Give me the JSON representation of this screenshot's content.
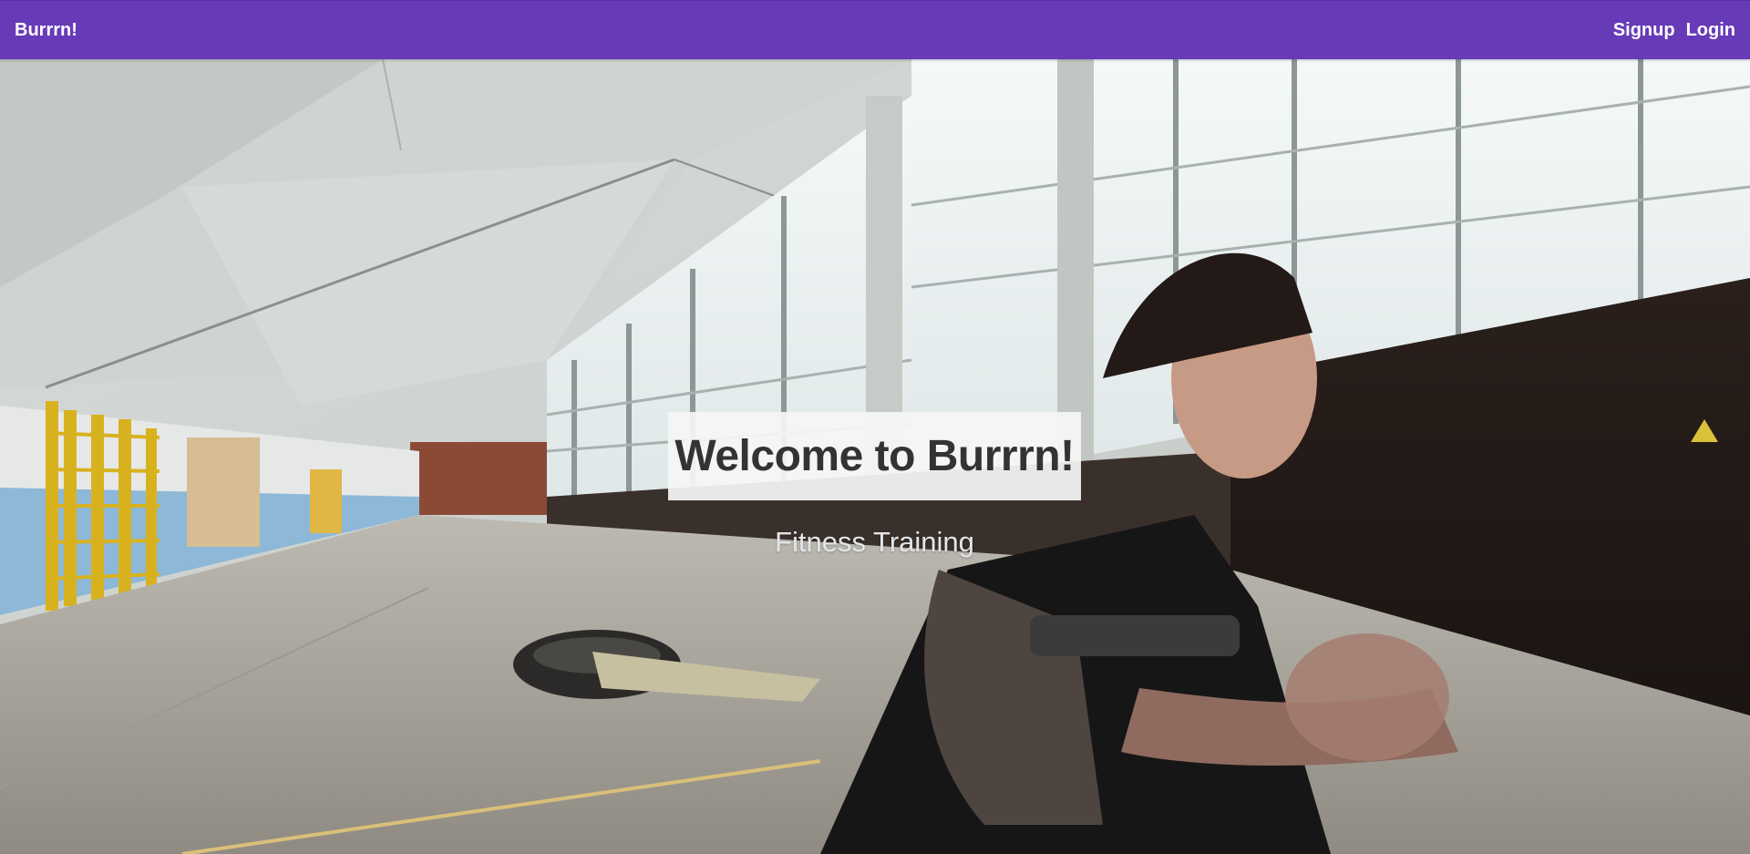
{
  "navbar": {
    "brand": "Burrrn!",
    "links": [
      {
        "label": "Signup"
      },
      {
        "label": "Login"
      }
    ],
    "background_color": "#673ab7"
  },
  "hero": {
    "title": "Welcome to Burrrn!",
    "subtitle": "Fitness Training",
    "background_description": "gym hall video background"
  }
}
